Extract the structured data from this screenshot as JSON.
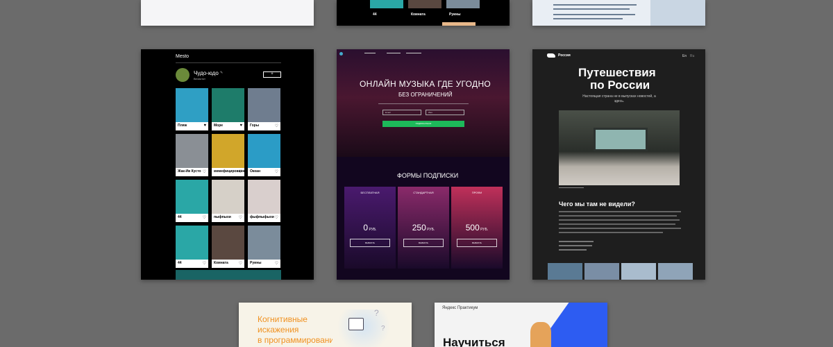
{
  "mesto": {
    "logo": "Mesto",
    "profile_name": "Чудо-юдо",
    "profile_sub": "Вечнотот",
    "edit_icon": "pencil-icon",
    "add_icon": "plus-icon",
    "cards": [
      {
        "caption": "Пляж",
        "color": "#2f9fc4"
      },
      {
        "caption": "Море",
        "color": "#1e7c6a"
      },
      {
        "caption": "Горы",
        "color": "#6f7d8f"
      },
      {
        "caption": "Жак-Ив Кусто",
        "color": "#8a8f95"
      },
      {
        "caption": "мемефицированный",
        "color": "#d1a62a"
      },
      {
        "caption": "Океан",
        "color": "#2b9cc6"
      },
      {
        "caption": "44",
        "color": "#2aa7a6"
      },
      {
        "caption": "пыфпыхи",
        "color": "#d6d0c8"
      },
      {
        "caption": "фыфпыфыхи",
        "color": "#d9cfcd"
      },
      {
        "caption": "44",
        "color": "#2aa7a6"
      },
      {
        "caption": "Комната",
        "color": "#5a4840"
      },
      {
        "caption": "Руины",
        "color": "#7b8c9b"
      }
    ],
    "like_icon": "heart-icon"
  },
  "music": {
    "title": "ОНЛАЙН МУЗЫКА ГДЕ УГОДНО",
    "subtitle": "БЕЗ ОГРАНИЧЕНИЙ",
    "email_placeholder": "Email",
    "name_placeholder": "Имя",
    "cta": "ПОДПИСАТЬСЯ",
    "plans_title": "ФОРМЫ ПОДПИСКИ",
    "plans": [
      {
        "name": "БЕСПЛАТНАЯ",
        "price": "0",
        "unit": "РУБ.",
        "button": "ВЫБРАТЬ",
        "color": "#4a1a6e"
      },
      {
        "name": "СТАНДАРТНАЯ",
        "price": "250",
        "unit": "РУБ.",
        "button": "ВЫБРАТЬ",
        "color": "#8a2a6a"
      },
      {
        "name": "ПРОФИ",
        "price": "500",
        "unit": "РУБ.",
        "button": "ВЫБРАТЬ",
        "color": "#c0305a"
      }
    ]
  },
  "russia": {
    "logo": "Россия",
    "lang": "En",
    "lang2": "Ru",
    "title_line1": "Путешествия",
    "title_line2": "по России",
    "lead": "Настоящая страна не в выпусках новостей, а здесь.",
    "section_title": "Чего мы там не видели?"
  },
  "cognitive": {
    "line1": "Когнитивные",
    "line2": "искажения",
    "line3": "в программировании"
  },
  "yandex": {
    "brand": "Яндекс Практикум",
    "headline": "Научиться"
  }
}
